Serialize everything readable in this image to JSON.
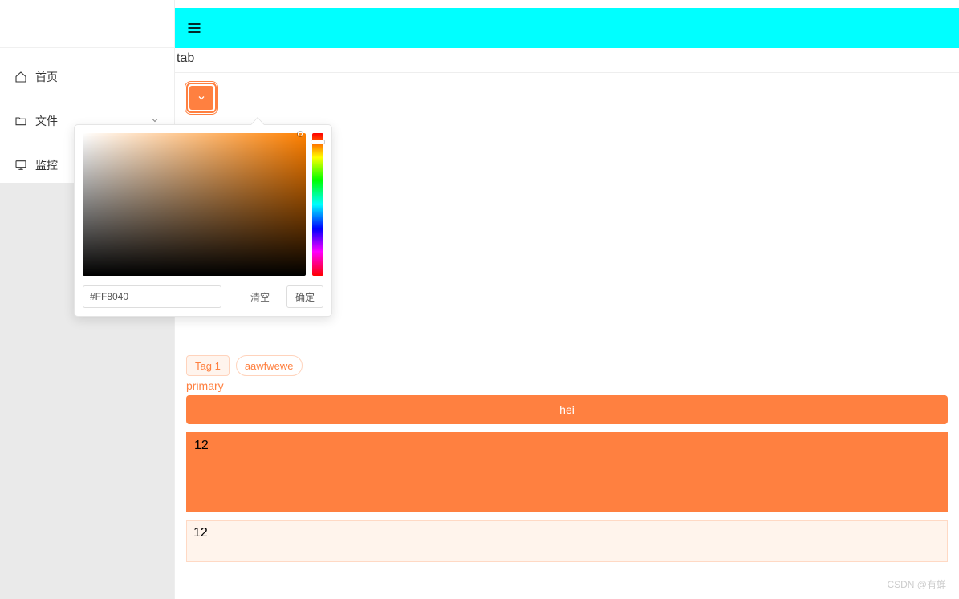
{
  "sidebar": {
    "items": [
      {
        "label": "首页",
        "icon": "home-icon",
        "expandable": false
      },
      {
        "label": "文件",
        "icon": "folder-icon",
        "expandable": true
      },
      {
        "label": "监控",
        "icon": "monitor-icon",
        "expandable": false
      }
    ]
  },
  "header": {
    "tab_label": "tab"
  },
  "colorpicker": {
    "selected_hex": "#FF8040",
    "clear_label": "清空",
    "confirm_label": "确定"
  },
  "tags": [
    {
      "label": "Tag 1",
      "style": "filled"
    },
    {
      "label": "aawfwewe",
      "style": "round"
    }
  ],
  "primary_text": "primary",
  "hei_button": "hei",
  "alerts": [
    {
      "text": "12",
      "variant": "solid"
    },
    {
      "text": "12",
      "variant": "light"
    }
  ],
  "theme": {
    "primary": "#FF8040",
    "topbar": "#00FFFF"
  },
  "watermark": "CSDN @有蝉"
}
